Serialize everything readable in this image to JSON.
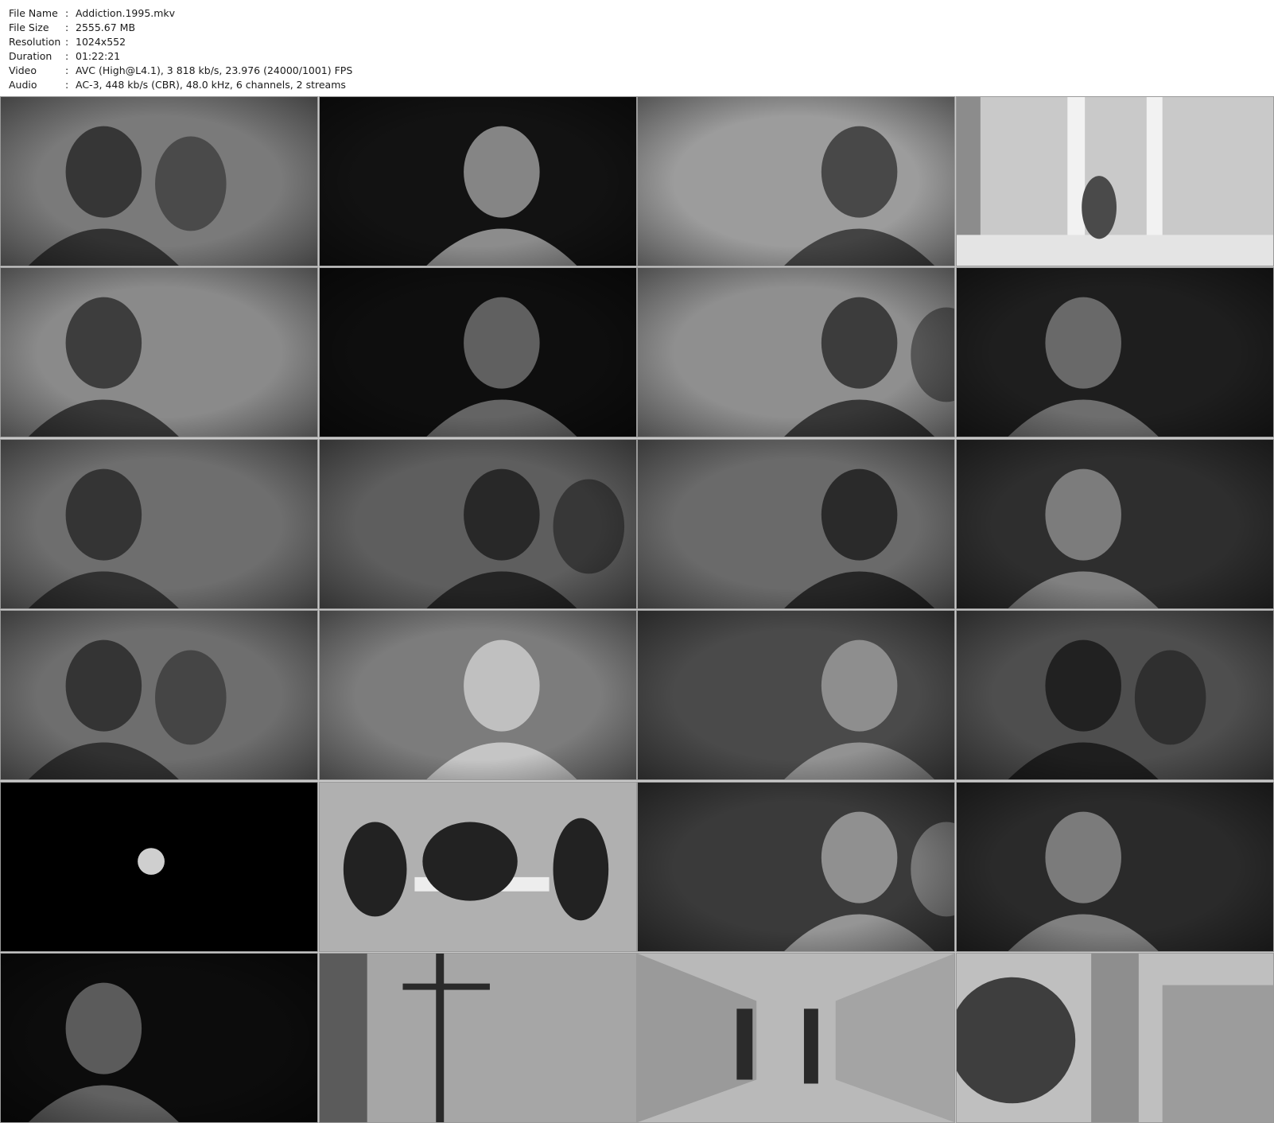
{
  "file_info": [
    {
      "label": "File Name",
      "sep": ":",
      "value": "Addiction.1995.mkv"
    },
    {
      "label": "File Size",
      "sep": ":",
      "value": "2555.67 MB"
    },
    {
      "label": "Resolution",
      "sep": ":",
      "value": "1024x552"
    },
    {
      "label": "Duration",
      "sep": ":",
      "value": "01:22:21"
    },
    {
      "label": "Video",
      "sep": ":",
      "value": "AVC (High@L4.1), 3 818 kb/s, 23.976 (24000/1001) FPS"
    },
    {
      "label": "Audio",
      "sep": ":",
      "value": "AC-3, 448 kb/s (CBR), 48.0 kHz, 6 channels, 2 streams"
    }
  ],
  "thumbnails": [
    {
      "scene": "two-women-talking",
      "bg": "#7a7a7a",
      "fg": "#2a2a2a"
    },
    {
      "scene": "face-in-shadow-lattice",
      "bg": "#121212",
      "fg": "#9a9a9a"
    },
    {
      "scene": "woman-at-mirror",
      "bg": "#9c9c9c",
      "fg": "#3a3a3a"
    },
    {
      "scene": "restroom-stalls",
      "bg": "#c9c9c9",
      "fg": "#4a4a4a"
    },
    {
      "scene": "woman-eating-at-cafe",
      "bg": "#8a8a8a",
      "fg": "#2f2f2f"
    },
    {
      "scene": "close-up-face-dark",
      "bg": "#0e0e0e",
      "fg": "#6e6e6e"
    },
    {
      "scene": "classroom-students",
      "bg": "#8f8f8f",
      "fg": "#2e2e2e"
    },
    {
      "scene": "cafe-table-three-people",
      "bg": "#1e1e1e",
      "fg": "#777777"
    },
    {
      "scene": "man-with-glasses",
      "bg": "#6e6e6e",
      "fg": "#2a2a2a"
    },
    {
      "scene": "library-reading-room",
      "bg": "#5e5e5e",
      "fg": "#1e1e1e"
    },
    {
      "scene": "two-women-in-room",
      "bg": "#6a6a6a",
      "fg": "#1f1f1f"
    },
    {
      "scene": "night-street-walk",
      "bg": "#2e2e2e",
      "fg": "#8a8a8a"
    },
    {
      "scene": "woman-in-sunglasses",
      "bg": "#6e6e6e",
      "fg": "#2a2a2a"
    },
    {
      "scene": "building-caryatid-statue",
      "bg": "#7c7c7c",
      "fg": "#cdcdcd"
    },
    {
      "scene": "loft-interior",
      "bg": "#4a4a4a",
      "fg": "#9a9a9a"
    },
    {
      "scene": "man-on-bed",
      "bg": "#4e4e4e",
      "fg": "#1a1a1a"
    },
    {
      "scene": "moon-night-sky",
      "bg": "#000000",
      "fg": "#cfcfcf"
    },
    {
      "scene": "meeting-table",
      "bg": "#b0b0b0",
      "fg": "#222222"
    },
    {
      "scene": "blurred-motion",
      "bg": "#3a3a3a",
      "fg": "#a0a0a0"
    },
    {
      "scene": "figure-on-floor",
      "bg": "#2a2a2a",
      "fg": "#8a8a8a"
    },
    {
      "scene": "dark-struggle",
      "bg": "#0c0c0c",
      "fg": "#6a6a6a"
    },
    {
      "scene": "crucifix-on-wall",
      "bg": "#a6a6a6",
      "fg": "#2a2a2a"
    },
    {
      "scene": "hospital-corridor",
      "bg": "#b9b9b9",
      "fg": "#2a2a2a"
    },
    {
      "scene": "church-tower",
      "bg": "#bfbfbf",
      "fg": "#3e3e3e"
    }
  ]
}
